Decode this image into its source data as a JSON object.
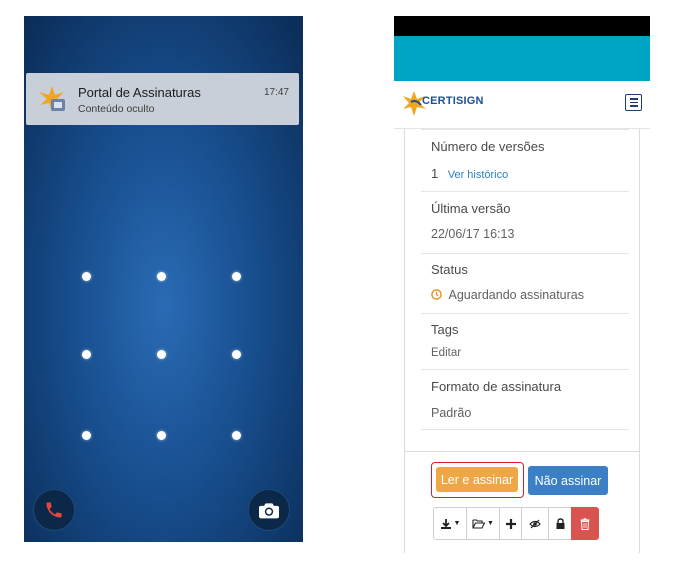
{
  "lock_screen": {
    "notification": {
      "app_name": "Portal de Assinaturas",
      "subtitle": "Conteúdo oculto",
      "time": "17:47"
    },
    "pattern_dots": 9,
    "shortcuts": [
      "phone-icon",
      "camera-icon"
    ],
    "colors": {
      "background": "#184f8f",
      "phone_icon": "#e8453c"
    }
  },
  "app": {
    "brand": "CERTISIGN",
    "colors": {
      "appbar": "#00a5c5",
      "link": "#2d7fc1",
      "pending": "#e29a2a",
      "primary": "#3b80c6",
      "warning": "#eea744",
      "danger": "#d9534f"
    },
    "details": {
      "versions_label": "Número de versões",
      "versions_count": "1",
      "versions_link": "Ver histórico",
      "last_version_label": "Última versão",
      "last_version_value": "22/06/17 16:13",
      "status_label": "Status",
      "status_value": "Aguardando assinaturas",
      "tags_label": "Tags",
      "tags_link": "Editar",
      "format_label": "Formato de assinatura",
      "format_value": "Padrão"
    },
    "actions": {
      "read_and_sign": "Ler e assinar",
      "do_not_sign": "Não assinar"
    },
    "toolbar_icons": [
      "download-icon",
      "folder-open-icon",
      "plus-icon",
      "eye-slash-icon",
      "lock-icon",
      "trash-icon"
    ]
  }
}
